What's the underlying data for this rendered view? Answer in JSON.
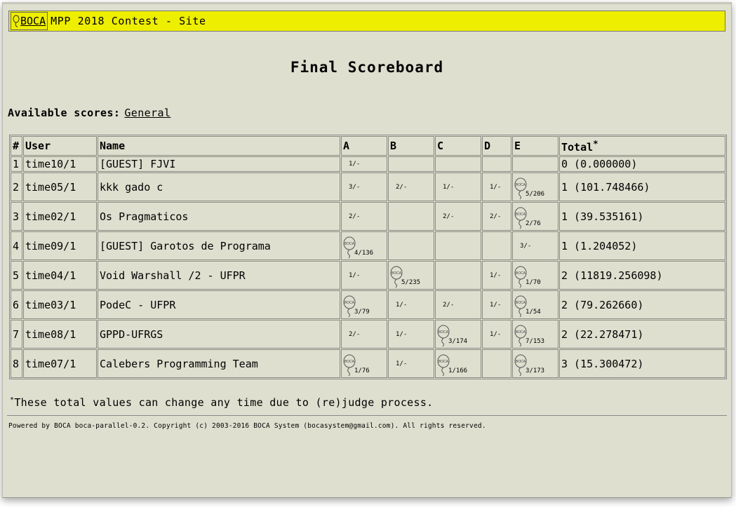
{
  "header": {
    "logo_text": "BOCA",
    "title": "MPP 2018 Contest - Site"
  },
  "page_title": "Final Scoreboard",
  "available_scores": {
    "label": "Available scores:",
    "link": "General"
  },
  "table": {
    "columns": [
      "#",
      "User",
      "Name",
      "A",
      "B",
      "C",
      "D",
      "E",
      "Total"
    ],
    "total_mark": "*",
    "rows": [
      {
        "rank": "1",
        "user": "time10/1",
        "name": "[GUEST] FJVI",
        "problems": [
          {
            "v": "1/-",
            "s": false
          },
          {
            "v": "",
            "s": false
          },
          {
            "v": "",
            "s": false
          },
          {
            "v": "",
            "s": false
          },
          {
            "v": "",
            "s": false
          }
        ],
        "total": "0 (0.000000)"
      },
      {
        "rank": "2",
        "user": "time05/1",
        "name": "kkk gado c",
        "problems": [
          {
            "v": "3/-",
            "s": false
          },
          {
            "v": "2/-",
            "s": false
          },
          {
            "v": "1/-",
            "s": false
          },
          {
            "v": "1/-",
            "s": false
          },
          {
            "v": "5/206",
            "s": true
          }
        ],
        "total": "1 (101.748466)"
      },
      {
        "rank": "3",
        "user": "time02/1",
        "name": "Os Pragmaticos",
        "problems": [
          {
            "v": "2/-",
            "s": false
          },
          {
            "v": "",
            "s": false
          },
          {
            "v": "2/-",
            "s": false
          },
          {
            "v": "2/-",
            "s": false
          },
          {
            "v": "2/76",
            "s": true
          }
        ],
        "total": "1 (39.535161)"
      },
      {
        "rank": "4",
        "user": "time09/1",
        "name": "[GUEST] Garotos de Programa",
        "problems": [
          {
            "v": "4/136",
            "s": true
          },
          {
            "v": "",
            "s": false
          },
          {
            "v": "",
            "s": false
          },
          {
            "v": "",
            "s": false
          },
          {
            "v": "3/-",
            "s": false
          }
        ],
        "total": "1 (1.204052)"
      },
      {
        "rank": "5",
        "user": "time04/1",
        "name": "Void Warshall /2 - UFPR",
        "problems": [
          {
            "v": "1/-",
            "s": false
          },
          {
            "v": "5/235",
            "s": true
          },
          {
            "v": "",
            "s": false
          },
          {
            "v": "1/-",
            "s": false
          },
          {
            "v": "1/70",
            "s": true
          }
        ],
        "total": "2 (11819.256098)"
      },
      {
        "rank": "6",
        "user": "time03/1",
        "name": "PodeC - UFPR",
        "problems": [
          {
            "v": "3/79",
            "s": true
          },
          {
            "v": "1/-",
            "s": false
          },
          {
            "v": "2/-",
            "s": false
          },
          {
            "v": "1/-",
            "s": false
          },
          {
            "v": "1/54",
            "s": true
          }
        ],
        "total": "2 (79.262660)"
      },
      {
        "rank": "7",
        "user": "time08/1",
        "name": "GPPD-UFRGS",
        "problems": [
          {
            "v": "2/-",
            "s": false
          },
          {
            "v": "1/-",
            "s": false
          },
          {
            "v": "3/174",
            "s": true
          },
          {
            "v": "1/-",
            "s": false
          },
          {
            "v": "7/153",
            "s": true
          }
        ],
        "total": "2 (22.278471)"
      },
      {
        "rank": "8",
        "user": "time07/1",
        "name": "Calebers Programming Team",
        "problems": [
          {
            "v": "1/76",
            "s": true
          },
          {
            "v": "1/-",
            "s": false
          },
          {
            "v": "1/166",
            "s": true
          },
          {
            "v": "",
            "s": false
          },
          {
            "v": "3/173",
            "s": true
          }
        ],
        "total": "3 (15.300472)"
      }
    ]
  },
  "balloon_label": "BOCA",
  "note": {
    "mark": "*",
    "text": "These total values can change any time due to (re)judge process."
  },
  "footer": "Powered by BOCA boca-parallel-0.2. Copyright (c) 2003-2016 BOCA System (bocasystem@gmail.com). All rights reserved."
}
